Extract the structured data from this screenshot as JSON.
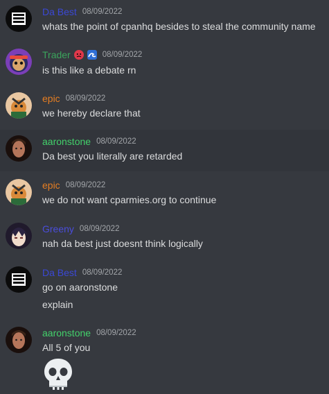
{
  "colors": {
    "background": "#36393f",
    "highlight_row": "#32353b",
    "da_best": "#3b48d6",
    "trader": "#3ba55c",
    "epic": "#e67e22",
    "aaronstone": "#43d16b",
    "greeny": "#4a4ddb",
    "timestamp": "#a3a6aa",
    "text": "#dcddde"
  },
  "messages": [
    {
      "author": "Da Best",
      "timestamp": "08/09/2022",
      "lines": [
        "whats the point of cpanhq besides to steal the community name"
      ],
      "avatar_icon": "gta-logo-avatar"
    },
    {
      "author": "Trader",
      "timestamp": "08/09/2022",
      "lines": [
        "is this like a debate rn"
      ],
      "badges": [
        "angry-face-icon",
        "wave-icon"
      ],
      "avatar_icon": "monkey-avatar"
    },
    {
      "author": "epic",
      "timestamp": "08/09/2022",
      "lines": [
        "we hereby declare that"
      ],
      "avatar_icon": "cartoon-avatar"
    },
    {
      "author": "aaronstone",
      "timestamp": "08/09/2022",
      "lines": [
        "Da best you literally are retarded"
      ],
      "avatar_icon": "person-avatar"
    },
    {
      "author": "epic",
      "timestamp": "08/09/2022",
      "lines": [
        "we do not want cparmies.org to continue"
      ],
      "avatar_icon": "cartoon-avatar"
    },
    {
      "author": "Greeny",
      "timestamp": "08/09/2022",
      "lines": [
        "nah da best just doesnt think logically"
      ],
      "avatar_icon": "anime-avatar"
    },
    {
      "author": "Da Best",
      "timestamp": "08/09/2022",
      "lines": [
        "go on aaronstone",
        "explain"
      ],
      "avatar_icon": "gta-logo-avatar"
    },
    {
      "author": "aaronstone",
      "timestamp": "08/09/2022",
      "lines": [
        "All 5 of you"
      ],
      "emoji": "skull-emoji",
      "avatar_icon": "person-avatar"
    }
  ]
}
